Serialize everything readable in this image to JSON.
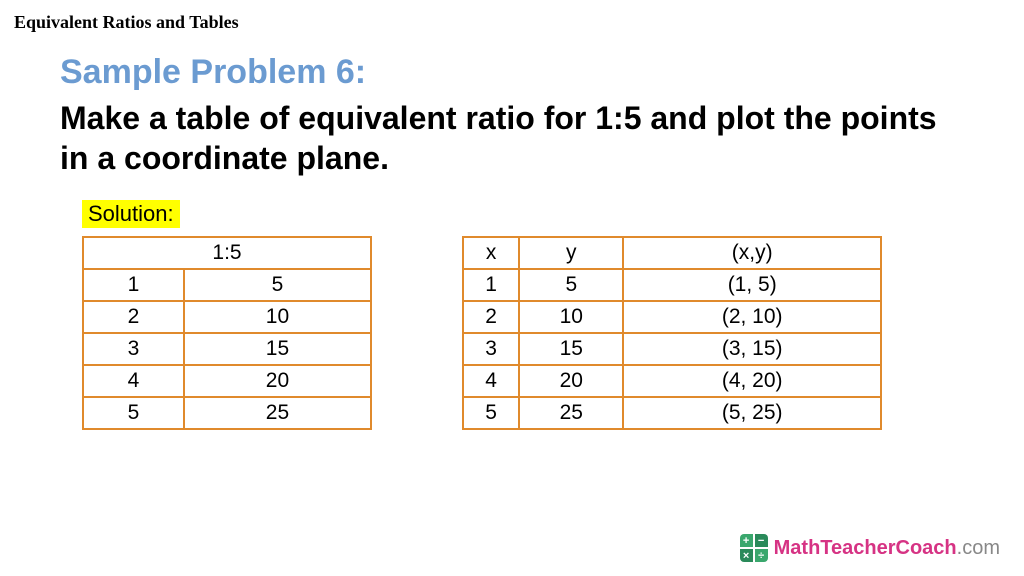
{
  "header": "Equivalent Ratios and Tables",
  "sample_title": "Sample Problem 6:",
  "prompt": "Make a table of equivalent ratio for 1:5 and plot the points in a coordinate plane.",
  "solution_label": "Solution:",
  "left_table": {
    "header": "1:5",
    "rows": [
      [
        "1",
        "5"
      ],
      [
        "2",
        "10"
      ],
      [
        "3",
        "15"
      ],
      [
        "4",
        "20"
      ],
      [
        "5",
        "25"
      ]
    ]
  },
  "right_table": {
    "headers": [
      "x",
      "y",
      "(x,y)"
    ],
    "rows": [
      [
        "1",
        "5",
        "(1, 5)"
      ],
      [
        "2",
        "10",
        "(2, 10)"
      ],
      [
        "3",
        "15",
        "(3, 15)"
      ],
      [
        "4",
        "20",
        "(4, 20)"
      ],
      [
        "5",
        "25",
        "(5, 25)"
      ]
    ]
  },
  "footer": {
    "brand": "MathTeacherCoach",
    "tld": ".com"
  }
}
